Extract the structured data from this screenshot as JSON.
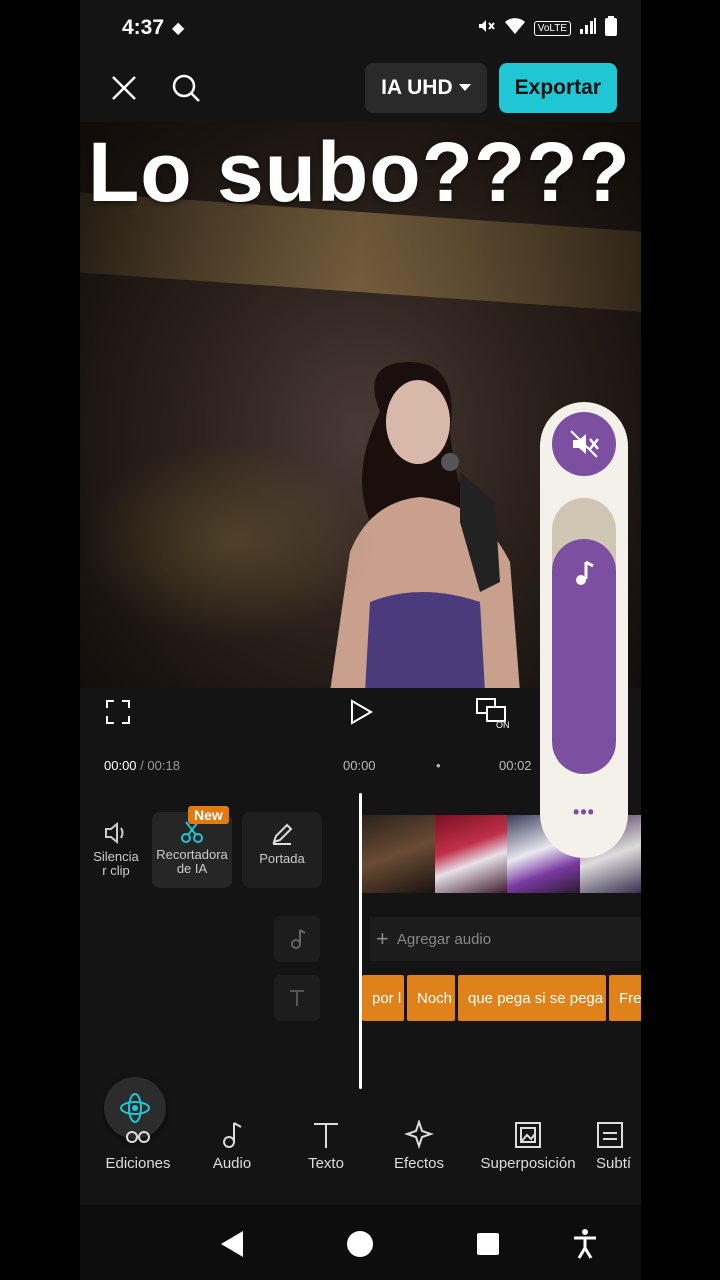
{
  "status_bar": {
    "time": "4:37",
    "network": "VoLTE"
  },
  "top_bar": {
    "quality_label": "IA UHD",
    "export_label": "Exportar"
  },
  "video": {
    "caption": "Lo subo????"
  },
  "timeline": {
    "current_time": "00:00",
    "total_time": "/ 00:18",
    "ruler": [
      "00:00",
      "00:02"
    ],
    "tools": [
      {
        "label": "Silencia\nr clip",
        "icon": "speaker-icon"
      },
      {
        "label": "Recortadora\nde IA",
        "icon": "ai-cutter-icon",
        "badge": "New"
      },
      {
        "label": "Portada",
        "icon": "pencil-icon"
      }
    ],
    "add_audio_label": "Agregar audio",
    "text_clips": [
      "por l",
      "Noch",
      "que pega si se pega",
      "Fre"
    ]
  },
  "volume_panel": {
    "level": 0.85,
    "more_label": "•••"
  },
  "bottom_tabs": [
    "Ediciones",
    "Audio",
    "Texto",
    "Efectos",
    "Superposición",
    "Subtí"
  ],
  "colors": {
    "accent": "#21c6d4",
    "volume": "#7d4fa0",
    "text_clip": "#e0821a",
    "badge": "#e07a12"
  }
}
